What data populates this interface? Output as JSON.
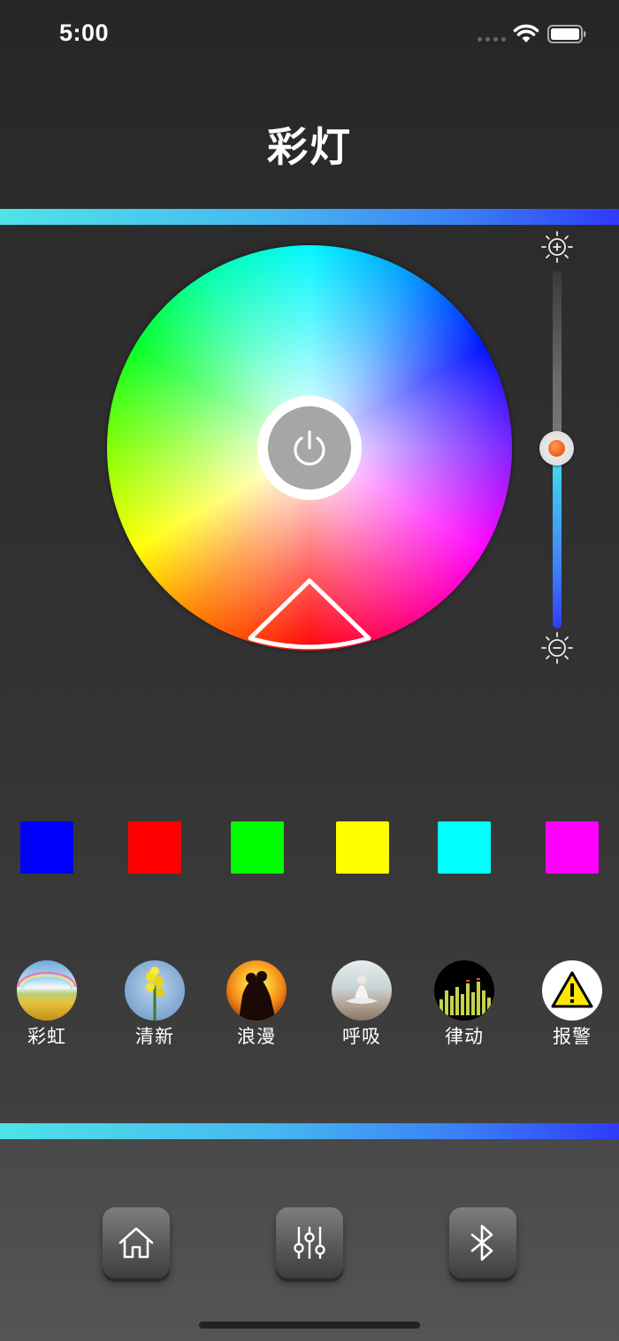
{
  "status_bar": {
    "time": "5:00"
  },
  "header": {
    "title": "彩灯"
  },
  "color_wheel": {
    "selected_color": "#ff0000"
  },
  "brightness": {
    "level_fraction": 0.5
  },
  "swatches": [
    "#0000ff",
    "#ff0000",
    "#00ff00",
    "#ffff00",
    "#00ffff",
    "#ff00ff"
  ],
  "modes": [
    {
      "label": "彩虹",
      "icon": "rainbow-scene-icon"
    },
    {
      "label": "清新",
      "icon": "rapeseed-flower-icon"
    },
    {
      "label": "浪漫",
      "icon": "couple-sunset-icon"
    },
    {
      "label": "呼吸",
      "icon": "meditation-icon"
    },
    {
      "label": "律动",
      "icon": "equalizer-icon"
    },
    {
      "label": "报警",
      "icon": "warning-icon"
    }
  ],
  "bottom_nav": [
    "home-icon",
    "sliders-icon",
    "bluetooth-icon"
  ]
}
